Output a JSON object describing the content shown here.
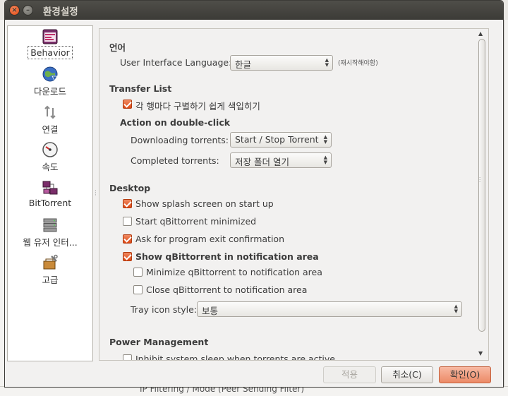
{
  "window": {
    "title": "환경설정"
  },
  "background": {
    "bottom_text": "IP Filtering / Mode (Peer Sending Filter)"
  },
  "sidebar": {
    "items": [
      {
        "label": "Behavior",
        "icon": "behavior-icon",
        "selected": true
      },
      {
        "label": "다운로드",
        "icon": "globe-download-icon"
      },
      {
        "label": "연결",
        "icon": "connection-arrows-icon"
      },
      {
        "label": "속도",
        "icon": "speed-gauge-icon"
      },
      {
        "label": "BitTorrent",
        "icon": "bittorrent-network-icon"
      },
      {
        "label": "웹 유저 인터...",
        "icon": "web-ui-server-icon"
      },
      {
        "label": "고급",
        "icon": "advanced-tools-icon"
      }
    ]
  },
  "language": {
    "section": "언어",
    "label": "User Interface Language:",
    "value": "한글",
    "hint": "(재시작해야함)"
  },
  "transfer_list": {
    "section": "Transfer List",
    "alt_rows_label": "각 행마다 구별하기 쉽게 색입히기",
    "alt_rows_checked": true,
    "double_click_header": "Action on double-click",
    "downloading_label": "Downloading torrents:",
    "downloading_value": "Start / Stop Torrent",
    "completed_label": "Completed torrents:",
    "completed_value": "저장 폴더 열기"
  },
  "desktop": {
    "section": "Desktop",
    "options": [
      {
        "label": "Show splash screen on start up",
        "checked": true
      },
      {
        "label": "Start qBittorrent minimized",
        "checked": false
      },
      {
        "label": "Ask for program exit confirmation",
        "checked": true
      },
      {
        "label": "Show qBittorrent in notification area",
        "checked": true
      }
    ],
    "sub_options": [
      {
        "label": "Minimize qBittorrent to notification area",
        "checked": false
      },
      {
        "label": "Close qBittorrent to notification area",
        "checked": false
      }
    ],
    "tray_label": "Tray icon style:",
    "tray_value": "보통"
  },
  "power": {
    "section": "Power Management",
    "inhibit_label": "Inhibit system sleep when torrents are active"
  },
  "buttons": {
    "apply": "적용",
    "cancel": "취소(C)",
    "ok": "확인(O)"
  },
  "colors": {
    "accent": "#dd4814",
    "titlebar": "#3c3b37",
    "ok_button": "#ec8a67"
  }
}
